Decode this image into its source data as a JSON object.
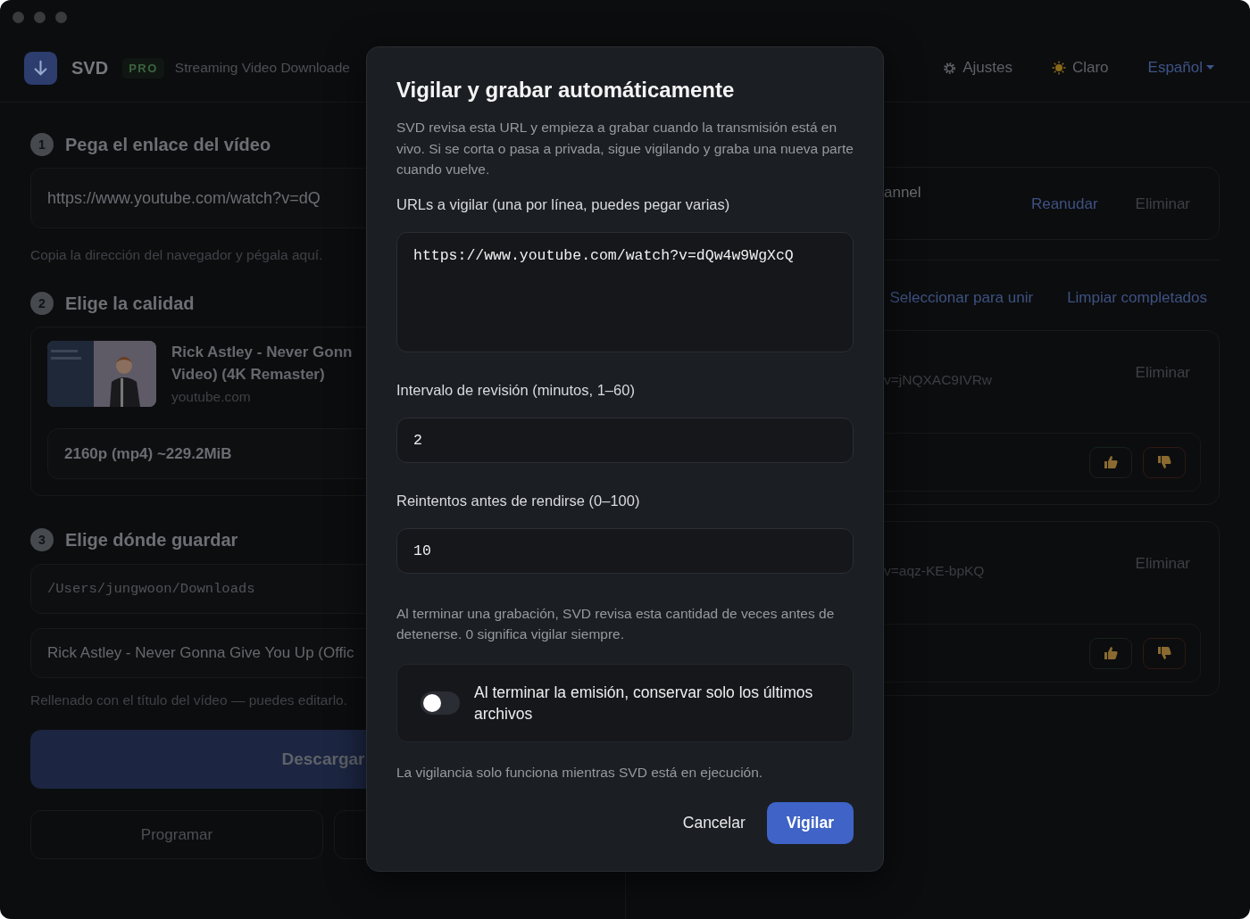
{
  "header": {
    "app_name": "SVD",
    "badge": "PRO",
    "subtitle": "Streaming Video Downloade",
    "settings": "Ajustes",
    "theme": "Claro",
    "language": "Español"
  },
  "steps": [
    {
      "number": "1",
      "title": "Pega el enlace del vídeo"
    },
    {
      "number": "2",
      "title": "Elige la calidad"
    },
    {
      "number": "3",
      "title": "Elige dónde guardar"
    }
  ],
  "url_field": {
    "value": "https://www.youtube.com/watch?v=dQ",
    "hint": "Copia la dirección del navegador y pégala aquí."
  },
  "video": {
    "kind": "picture",
    "title_lines": [
      "Rick Astley - Never Gonn",
      "Video) (4K Remaster)"
    ],
    "source": "youtube.com",
    "quality": "2160p (mp4) ~229.2MiB"
  },
  "save": {
    "folder": "/Users/jungwoon/Downloads",
    "filename": "Rick Astley - Never Gonna Give You Up (Offic",
    "hint": "Rellenado con el título del vídeo — puedes editarlo.",
    "download": "Descargar",
    "schedule": "Programar"
  },
  "queue": [
    {
      "title": "annel",
      "actions": [
        {
          "label": "Reanudar",
          "kind": "primary"
        },
        {
          "label": "Eliminar",
          "kind": "plain"
        }
      ]
    }
  ],
  "toolbar": [
    "Seleccionar para unir",
    "Limpiar completados"
  ],
  "downloads": [
    {
      "url_tail": "v=jNQXAC9IVRw",
      "delete": "Eliminar"
    },
    {
      "url_tail": "v=aqz-KE-bpKQ",
      "delete": "Eliminar"
    }
  ],
  "modal": {
    "title": "Vigilar y grabar automáticamente",
    "description": "SVD revisa esta URL y empieza a grabar cuando la transmisión está en vivo. Si se corta o pasa a privada, sigue vigilando y graba una nueva parte cuando vuelve.",
    "urls_label": "URLs a vigilar (una por línea, puedes pegar varias)",
    "urls_value": "https://www.youtube.com/watch?v=dQw4w9WgXcQ",
    "interval_label": "Intervalo de revisión (minutos, 1–60)",
    "interval_value": "2",
    "retries_label": "Reintentos antes de rendirse (0–100)",
    "retries_value": "10",
    "retries_hint": "Al terminar una grabación, SVD revisa esta cantidad de veces antes de detenerse. 0 significa vigilar siempre.",
    "keep_toggle": {
      "label": "Al terminar la emisión, conservar solo los últimos archivos",
      "on": false
    },
    "footer_note": "La vigilancia solo funciona mientras SVD está en ejecución.",
    "buttons": [
      {
        "label": "Cancelar",
        "kind": "secondary"
      },
      {
        "label": "Vigilar",
        "kind": "primary"
      }
    ]
  }
}
